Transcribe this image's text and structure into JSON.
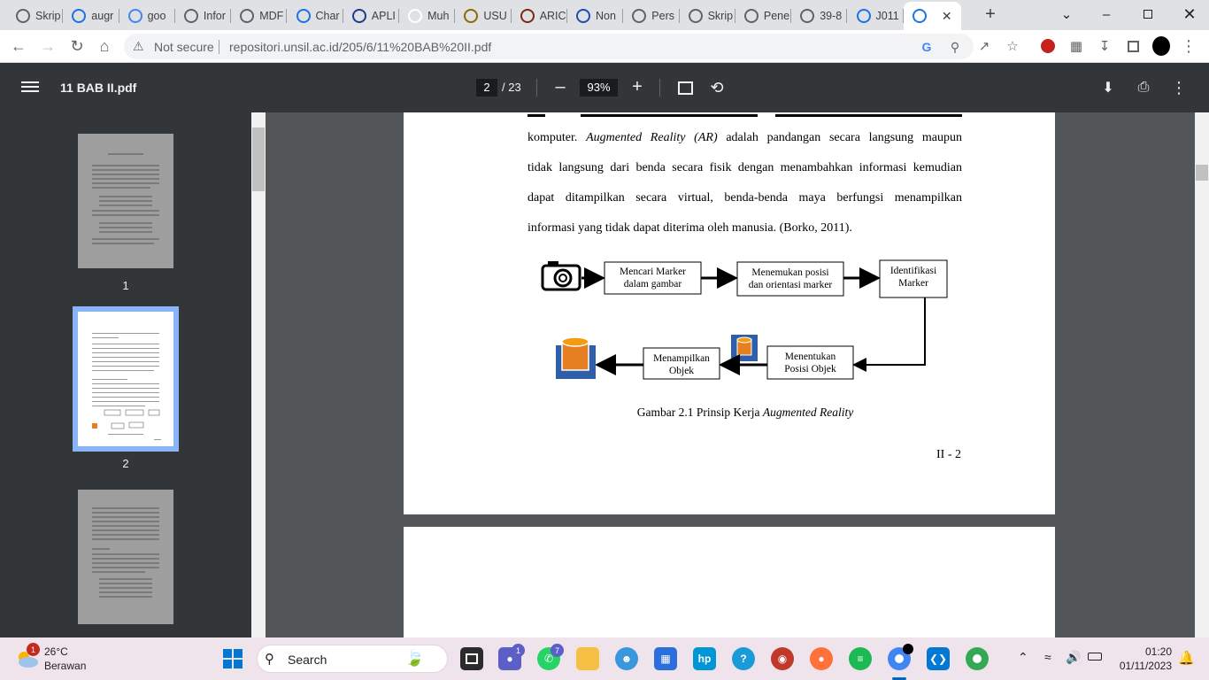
{
  "browser": {
    "tabs": [
      {
        "title": "Skrip",
        "icon": "openai-icon",
        "color": "#5f6368"
      },
      {
        "title": "augr",
        "icon": "stroke-icon",
        "color": "#1a73e8"
      },
      {
        "title": "goo",
        "icon": "google-icon",
        "color": "#4285f4"
      },
      {
        "title": "Infor",
        "icon": "lock-icon",
        "color": "#5f6368"
      },
      {
        "title": "MDF",
        "icon": "mdpi-icon",
        "color": "#5f6368"
      },
      {
        "title": "Char",
        "icon": "document-icon",
        "color": "#1a73e8"
      },
      {
        "title": "APLI",
        "icon": "d-icon",
        "color": "#1e3a8a"
      },
      {
        "title": "Muh",
        "icon": "researchgate-icon",
        "color": "#ffffff"
      },
      {
        "title": "USU",
        "icon": "usu-icon",
        "color": "#8b6b00"
      },
      {
        "title": "ARIC",
        "icon": "aric-icon",
        "color": "#7a2a12"
      },
      {
        "title": "Non",
        "icon": "globe-icon",
        "color": "#1a4fb0"
      },
      {
        "title": "Pers",
        "icon": "openai-icon",
        "color": "#5f6368"
      },
      {
        "title": "Skrip",
        "icon": "openai-icon",
        "color": "#5f6368"
      },
      {
        "title": "Pene",
        "icon": "circle-icon",
        "color": "#5f6368"
      },
      {
        "title": "39-8",
        "icon": "circle-icon",
        "color": "#5f6368"
      },
      {
        "title": "J011",
        "icon": "document-icon",
        "color": "#1a73e8"
      },
      {
        "title": "",
        "icon": "document-icon",
        "color": "#1a73e8",
        "active": true
      }
    ],
    "address": {
      "security_label": "Not secure",
      "url": "repositori.unsil.ac.id/205/6/11%20BAB%20II.pdf"
    }
  },
  "pdf": {
    "title": "11 BAB II.pdf",
    "current_page": "2",
    "total_pages": "/ 23",
    "zoom": "93%",
    "thumbnails": [
      {
        "label": "1"
      },
      {
        "label": "2"
      }
    ],
    "page": {
      "paragraph_lines": [
        "komputer. Augmented Reality (AR) adalah pandangan secara langsung maupun",
        "tidak langsung dari benda secara fisik dengan menambahkan informasi kemudian",
        "dapat ditampilkan secara virtual, benda-benda maya berfungsi menampilkan",
        "informasi yang tidak dapat diterima oleh manusia.  (Borko, 2011)."
      ],
      "paragraph_italic": "Augmented Reality (AR)",
      "diagram": {
        "box1": [
          "Mencari Marker",
          "dalam gambar"
        ],
        "box2": [
          "Menemukan posisi",
          "dan orientasi marker"
        ],
        "box3": [
          "Identifikasi",
          "Marker"
        ],
        "box4": [
          "Menentukan",
          "Posisi Objek"
        ],
        "box5": [
          "Menampilkan",
          "Objek"
        ]
      },
      "caption_prefix": "Gambar 2.1 Prinsip Kerja ",
      "caption_italic": "Augmented Reality",
      "page_number": "II - 2"
    }
  },
  "taskbar": {
    "weather_temp": "26°C",
    "weather_desc": "Berawan",
    "weather_badge": "1",
    "search_label": "Search",
    "time": "01:20",
    "date": "01/11/2023"
  }
}
